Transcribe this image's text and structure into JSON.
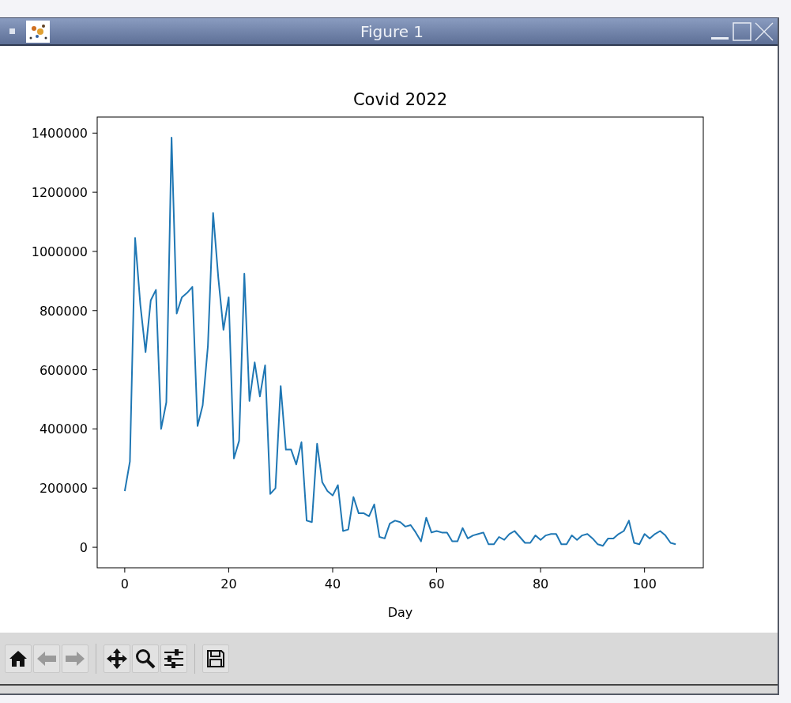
{
  "window": {
    "title": "Figure 1"
  },
  "figure": {
    "chart_data": {
      "type": "line",
      "title": "Covid 2022",
      "xlabel": "Day",
      "x": [
        0,
        1,
        2,
        3,
        4,
        5,
        6,
        7,
        8,
        9,
        10,
        11,
        12,
        13,
        14,
        15,
        16,
        17,
        18,
        19,
        20,
        21,
        22,
        23,
        24,
        25,
        26,
        27,
        28,
        29,
        30,
        31,
        32,
        33,
        34,
        35,
        36,
        37,
        38,
        39,
        40,
        41,
        42,
        43,
        44,
        45,
        46,
        47,
        48,
        49,
        50,
        51,
        52,
        53,
        54,
        55,
        56,
        57,
        58,
        59,
        60,
        61,
        62,
        63,
        64,
        65,
        66,
        67,
        68,
        69,
        70,
        71,
        72,
        73,
        74,
        75,
        76,
        77,
        78,
        79,
        80,
        81,
        82,
        83,
        84,
        85,
        86,
        87,
        88,
        89,
        90,
        91,
        92,
        93,
        94,
        95,
        96,
        97,
        98,
        99,
        100,
        101,
        102,
        103,
        104,
        105,
        106
      ],
      "series": [
        {
          "color": "#1f77b4",
          "values": [
            190000,
            290000,
            1045000,
            820000,
            660000,
            835000,
            870000,
            400000,
            490000,
            1385000,
            790000,
            845000,
            860000,
            880000,
            410000,
            480000,
            680000,
            1130000,
            910000,
            735000,
            845000,
            300000,
            360000,
            925000,
            495000,
            625000,
            510000,
            615000,
            180000,
            200000,
            545000,
            330000,
            330000,
            280000,
            355000,
            90000,
            85000,
            350000,
            220000,
            190000,
            175000,
            210000,
            55000,
            60000,
            170000,
            115000,
            115000,
            105000,
            145000,
            35000,
            30000,
            80000,
            90000,
            85000,
            70000,
            75000,
            50000,
            20000,
            100000,
            50000,
            55000,
            50000,
            50000,
            20000,
            20000,
            65000,
            30000,
            40000,
            45000,
            50000,
            10000,
            10000,
            35000,
            25000,
            45000,
            55000,
            35000,
            15000,
            15000,
            40000,
            25000,
            40000,
            45000,
            45000,
            10000,
            10000,
            40000,
            25000,
            40000,
            45000,
            30000,
            10000,
            5000,
            30000,
            30000,
            45000,
            55000,
            90000,
            15000,
            10000,
            45000,
            30000,
            45000,
            55000,
            40000,
            15000,
            10000
          ]
        }
      ],
      "xlim": [
        -5.3,
        111.3
      ],
      "ylim": [
        -69250,
        1454250
      ],
      "xticks": [
        0,
        20,
        40,
        60,
        80,
        100
      ],
      "yticks": [
        0,
        200000,
        400000,
        600000,
        800000,
        1000000,
        1200000,
        1400000
      ]
    }
  },
  "toolbar": {
    "buttons": [
      {
        "kind": "home",
        "disabled": false
      },
      {
        "kind": "back",
        "disabled": true
      },
      {
        "kind": "forward",
        "disabled": true
      },
      {
        "kind": "pan",
        "disabled": false
      },
      {
        "kind": "zoom",
        "disabled": false
      },
      {
        "kind": "configure",
        "disabled": false
      },
      {
        "kind": "save",
        "disabled": false
      }
    ]
  }
}
